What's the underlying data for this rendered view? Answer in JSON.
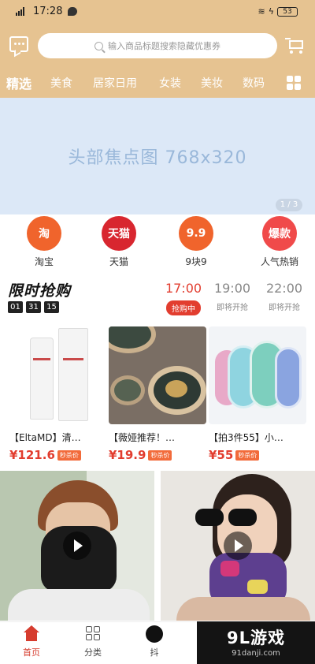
{
  "status_bar": {
    "time": "17:28",
    "battery": "53"
  },
  "search": {
    "placeholder": "输入商品标题搜索隐藏优惠券"
  },
  "tabs": [
    "精选",
    "美食",
    "居家日用",
    "女装",
    "美妆",
    "数码"
  ],
  "banner": {
    "text": "头部焦点图  768x320",
    "pager": "1 / 3"
  },
  "shortcuts": [
    {
      "icon_text": "淘",
      "label": "淘宝",
      "color": "#f0642c"
    },
    {
      "icon_text": "天猫",
      "label": "天猫",
      "color": "#d8262f"
    },
    {
      "icon_text": "9.9",
      "label": "9块9",
      "color": "#f0642c"
    },
    {
      "icon_text": "爆款",
      "label": "人气热销",
      "color": "#f04a4a"
    }
  ],
  "flash_sale": {
    "title": "限时抢购",
    "countdown": [
      "01",
      "31",
      "15"
    ],
    "slots": [
      {
        "time": "17:00",
        "status": "抢购中"
      },
      {
        "time": "19:00",
        "status": "即将开抢"
      },
      {
        "time": "22:00",
        "status": "即将开抢"
      }
    ]
  },
  "products": [
    {
      "name": "【EltaMD】清…",
      "price": "¥121.6",
      "badge": "秒杀价"
    },
    {
      "name": "【薇娅推荐！…",
      "price": "¥19.9",
      "badge": "秒杀价"
    },
    {
      "name": "【拍3件55】小…",
      "price": "¥55",
      "badge": "秒杀价"
    }
  ],
  "bottom_nav": [
    "首页",
    "分类",
    "抖"
  ],
  "watermark": {
    "brand": "9L游戏",
    "site": "91danji.com"
  },
  "colors": {
    "header": "#e6c391",
    "accent": "#e23d2f"
  }
}
